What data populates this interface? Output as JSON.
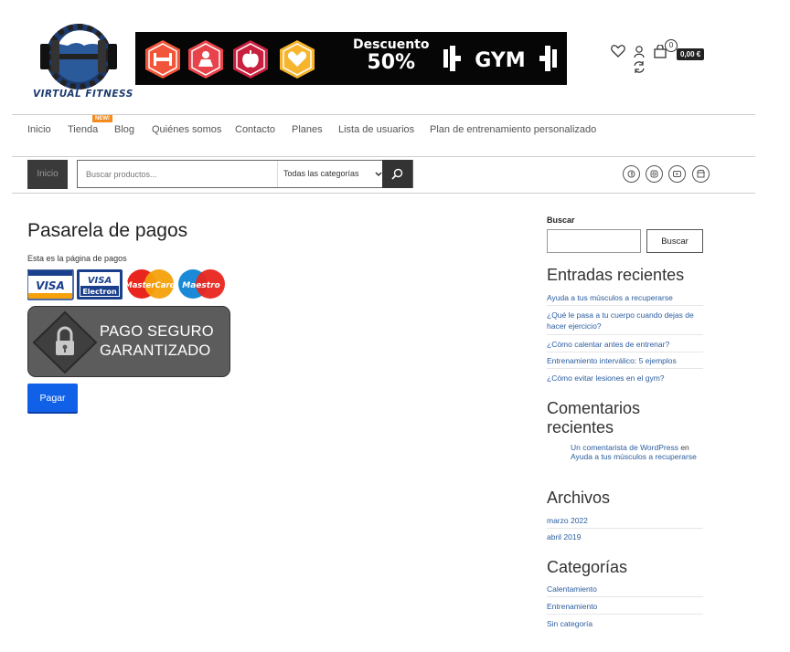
{
  "logo": {
    "text": "VIRTUAL FITNESS"
  },
  "banner": {
    "title_line1": "Descuento",
    "title_line2": "50%",
    "brand": "GYM",
    "hex_icons": [
      "dumbbell-icon",
      "scale-icon",
      "apple-icon",
      "heart-icon"
    ]
  },
  "header_icons": [
    "heart-icon",
    "user-icon",
    "refresh-icon",
    "bag-icon"
  ],
  "cart": {
    "count": "0",
    "total": "0,00 €"
  },
  "nav": {
    "items": [
      "Inicio",
      "Tienda",
      "Blog",
      "Quiénes somos",
      "Contacto",
      "Planes",
      "Lista de usuarios",
      "Plan de entrenamiento personalizado"
    ],
    "badge": "NEW!"
  },
  "search": {
    "home_label": "Inicio",
    "placeholder": "Buscar productos...",
    "category": "Todas las categorías"
  },
  "social_icons": [
    "facebook-icon",
    "instagram-icon",
    "youtube-icon",
    "store-icon"
  ],
  "main": {
    "title": "Pasarela de pagos",
    "text": "Esta es la página de pagos",
    "cards": [
      {
        "name": "visa",
        "label": "VISA"
      },
      {
        "name": "visa-electron",
        "label1": "VISA",
        "label2": "Electron"
      },
      {
        "name": "mastercard",
        "label": "MasterCard"
      },
      {
        "name": "maestro",
        "label": "Maestro"
      }
    ],
    "secure_line1": "PAGO SEGURO",
    "secure_line2": "GARANTIZADO",
    "pay_button": "Pagar"
  },
  "sidebar": {
    "search_label": "Buscar",
    "search_button": "Buscar",
    "recent_posts_title": "Entradas recientes",
    "recent_posts": [
      "Ayuda a tus músculos a recuperarse",
      "¿Qué le pasa a tu cuerpo cuando dejas de hacer ejercicio?",
      "¿Cómo calentar antes de entrenar?",
      "Entrenamiento interválico: 5 ejemplos",
      "¿Cómo evitar lesiones en el gym?"
    ],
    "recent_comments_title": "Comentarios recientes",
    "recent_comment": {
      "author": "Un comentarista de WordPress",
      "word": "en",
      "post": "Ayuda a tus músculos a recuperarse"
    },
    "archives_title": "Archivos",
    "archives": [
      "marzo 2022",
      "abril 2019"
    ],
    "categories_title": "Categorías",
    "categories": [
      "Calentamiento",
      "Entrenamiento",
      "Sin categoría"
    ]
  },
  "colors": {
    "accent": "#1161e8",
    "link": "#2a5d9f",
    "badge": "#f58a1f"
  }
}
